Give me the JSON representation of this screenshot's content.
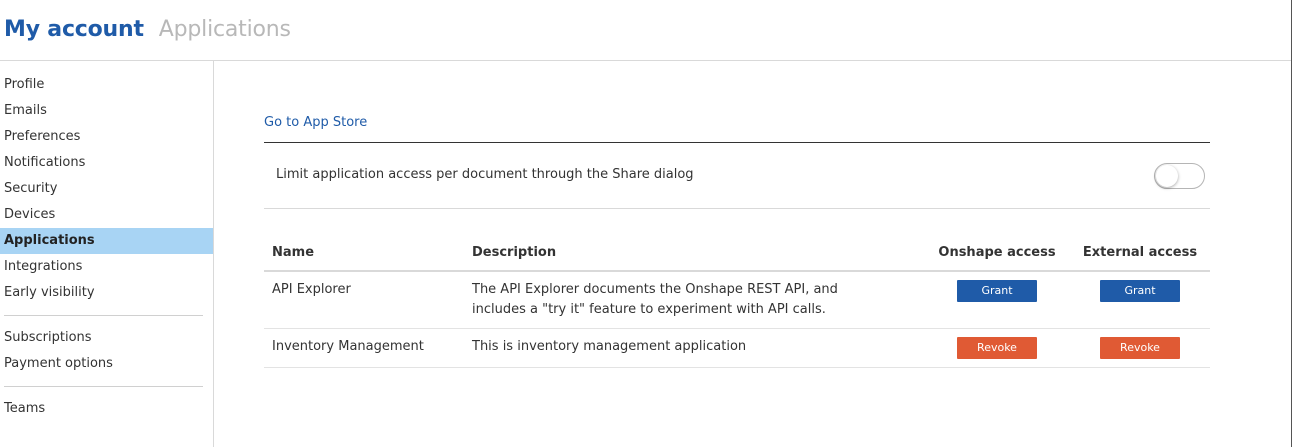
{
  "header": {
    "title": "My account",
    "subtitle": "Applications"
  },
  "sidebar": {
    "groups": [
      [
        "Profile",
        "Emails",
        "Preferences",
        "Notifications",
        "Security",
        "Devices",
        "Applications",
        "Integrations",
        "Early visibility"
      ],
      [
        "Subscriptions",
        "Payment options"
      ],
      [
        "Teams"
      ]
    ],
    "active": "Applications"
  },
  "main": {
    "app_store_link": "Go to App Store",
    "limit_label": "Limit application access per document through the Share dialog",
    "limit_toggle_on": false,
    "table": {
      "headers": [
        "Name",
        "Description",
        "Onshape access",
        "External access"
      ],
      "rows": [
        {
          "name": "API Explorer",
          "description": "The API Explorer documents the Onshape REST API, and includes a \"try it\" feature to experiment with API calls.",
          "onshape_action": "Grant",
          "external_action": "Grant"
        },
        {
          "name": "Inventory Management",
          "description": "This is inventory management application",
          "onshape_action": "Revoke",
          "external_action": "Revoke"
        }
      ]
    }
  },
  "colors": {
    "brand": "#1f5ba8",
    "active_sidebar": "#a8d4f4",
    "grant": "#1f5ba8",
    "revoke": "#e05a34"
  }
}
